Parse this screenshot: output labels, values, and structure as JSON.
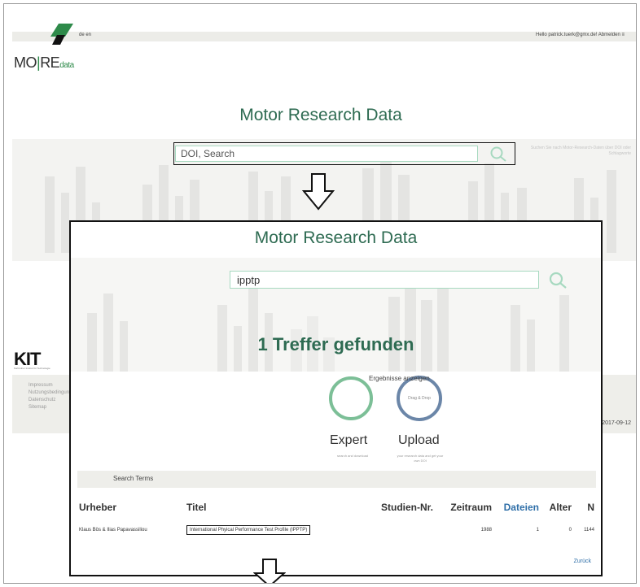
{
  "header": {
    "logo_text_1": "MO",
    "logo_text_sep": "|",
    "logo_text_2": "RE",
    "logo_text_3": "data",
    "languages": "de  en",
    "user_greeting": "Hello patrick.tuerk@gmx.de!",
    "logout": "Abmelden",
    "menu_glyph": "≡"
  },
  "back_page": {
    "title": "Motor Research Data",
    "search_placeholder": "DOI, Search",
    "search_help": "Suchen Sie nach Motor-Research-Daten über DOI oder Schlagworte",
    "footer_logo": "KIT",
    "footer_sub": "Karlsruher Institut für Technologie",
    "footer_links": [
      "Impressum",
      "Nutzungsbedingungen",
      "Datenschutz",
      "Sitemap"
    ],
    "footer_date": "2017-09-12"
  },
  "panel": {
    "title": "Motor Research Data",
    "search_value": "ipptp",
    "hits_text": "1 Treffer gefunden",
    "ergebnisse_label": "Ergebnisse anzeigen",
    "expert_label": "Expert",
    "expert_sub": "search and download",
    "upload_label": "Upload",
    "upload_ring_text": "Drag & Drop",
    "upload_sub": "your research data and get your own DOI",
    "search_terms_label": "Search Terms",
    "columns": [
      "Urheber",
      "Titel",
      "Studien-Nr.",
      "Zeitraum",
      "Dateien",
      "Alter",
      "N"
    ],
    "rows": [
      {
        "urheber": "Klaus Bös & Ilias Papavassiliou",
        "titel": "International Phyical Performance Test Profile (IPPTP)",
        "studien_nr": "",
        "zeitraum": "1988",
        "dateien": "1",
        "alter": "0",
        "n": "1144"
      }
    ],
    "back_link": "Zurück"
  },
  "icons": {
    "logo": "leaf-diamond-icon",
    "search": "magnifier-icon",
    "arrow": "down-arrow-icon"
  },
  "colors": {
    "brand_green": "#2e6b52",
    "accent_green": "#7cbf97",
    "accent_blue": "#2f6fa8",
    "search_border": "#a7d9c0"
  }
}
